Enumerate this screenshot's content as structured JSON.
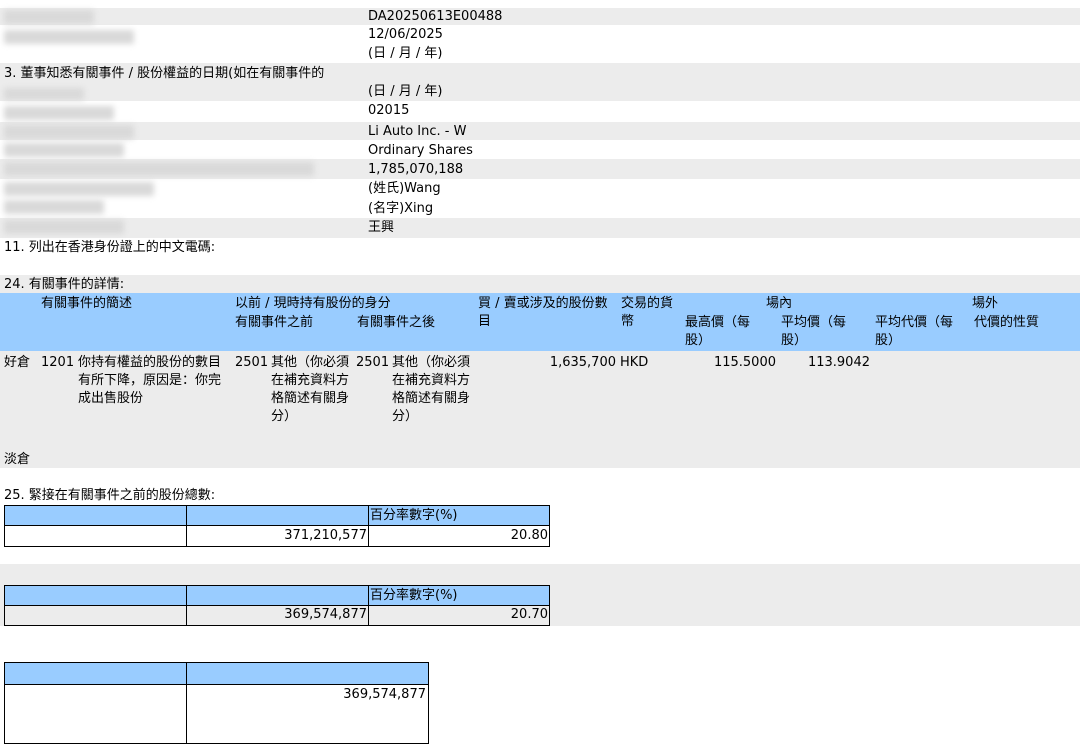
{
  "header_info": {
    "reference": "DA20250613E00488",
    "date_1": "12/06/2025",
    "date_format_1": "(日 / 月 / 年)",
    "q3_label": "3. 董事知悉有關事件 / 股份權益的日期(如在有關事件的",
    "date_format_2": "(日 / 月 / 年)",
    "stock_code": "02015",
    "company": "Li Auto Inc. - W",
    "share_class": "Ordinary Shares",
    "issued_shares": "1,785,070,188",
    "surname": "(姓氏)Wang",
    "given_name": "(名字)Xing",
    "chinese_name": "王興",
    "q11_label": "11. 列出在香港身份證上的中文電碼:"
  },
  "section24": {
    "title": "24. 有關事件的詳情:",
    "headers": {
      "description": "有關事件的簡述",
      "capacity": "以前 / 現時持有股份的身分",
      "before": "有關事件之前",
      "after": "有關事件之後",
      "shares": "買 / 賣或涉及的股份數目",
      "currency": "交易的貨幣",
      "on_exchange": "場內",
      "highest": "最高價（每股）",
      "average": "平均價（每股）",
      "avg_consideration": "平均代價（每股）",
      "off_exchange": "場外",
      "nature": "代價的性質"
    },
    "row": {
      "position": "好倉",
      "code": "1201",
      "description": "你持有權益的股份的數目有所下降，原因是：你完成出售股份",
      "before_code": "2501",
      "before_text": "其他（你必須在補充資料方格簡述有關身分）",
      "after_code": "2501",
      "after_text": "其他（你必須在補充資料方格簡述有關身分）",
      "shares": "1,635,700",
      "currency": "HKD",
      "highest": "115.5000",
      "average": "113.9042"
    },
    "short_label": "淡倉"
  },
  "section25": {
    "title": "25. 緊接在有關事件之前的股份總數:",
    "pct_header": "百分率數字(%)",
    "shares": "371,210,577",
    "pct": "20.80"
  },
  "section26": {
    "pct_header": "百分率數字(%)",
    "shares": "369,574,877",
    "pct": "20.70"
  },
  "section27": {
    "shares": "369,574,877"
  },
  "colors": {
    "header_blue": "#99ccff",
    "band_grey": "#ececec"
  }
}
